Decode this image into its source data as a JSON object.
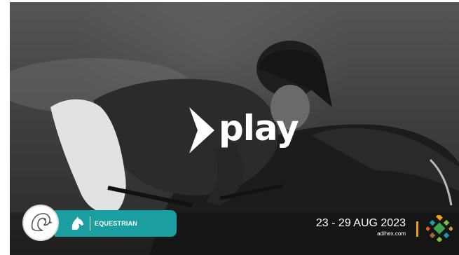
{
  "brand": {
    "play_word": "play"
  },
  "category": {
    "label": "EQUESTRIAN",
    "icon": "horse-head-icon",
    "color": "#1a9ea0"
  },
  "badge": {
    "icon": "falcon-emblem-icon"
  },
  "event": {
    "dates": "23 - 29 AUG 2023",
    "website": "adihex.com",
    "separator_color": "#f0a020",
    "logo_icon": "adihex-mosaic-logo-icon"
  },
  "colors": {
    "accent_teal": "#1a9ea0",
    "accent_orange": "#f0a020",
    "text_white": "#ffffff"
  }
}
